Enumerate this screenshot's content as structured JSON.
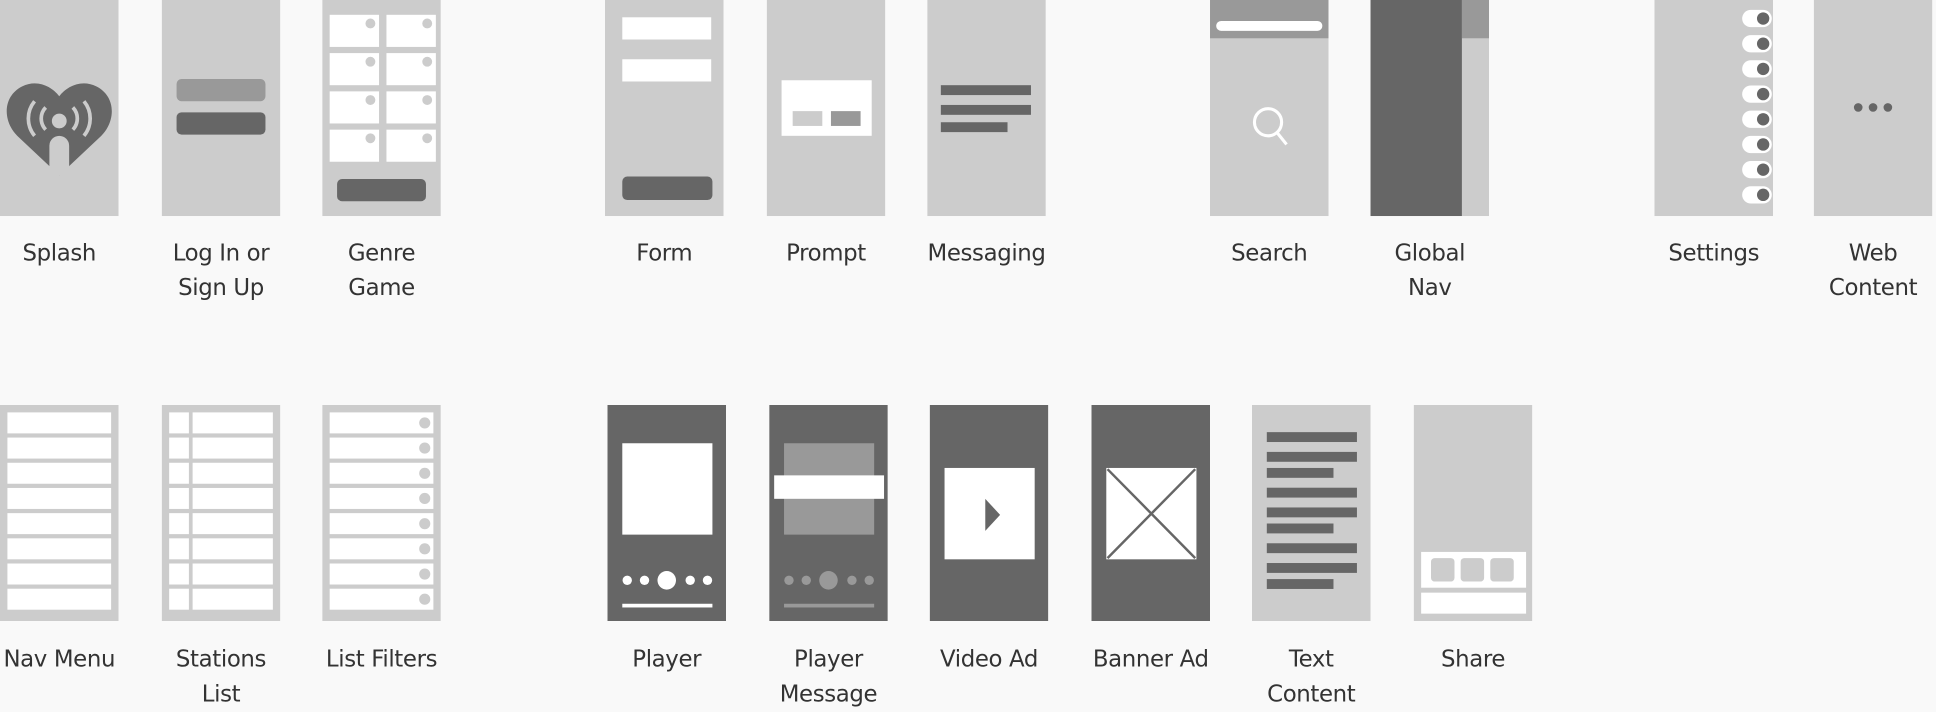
{
  "colors": {
    "background": "#f9f9f9",
    "light": "#cccccc",
    "mid": "#999999",
    "dark": "#666666",
    "white": "#ffffff",
    "text": "#333333"
  },
  "row1": [
    {
      "label": [
        "Splash"
      ],
      "icon": "iheart-logo-icon"
    },
    {
      "label": [
        "Log In or",
        "Sign Up"
      ]
    },
    {
      "label": [
        "Genre",
        "Game"
      ]
    },
    {
      "label": [
        "Form"
      ]
    },
    {
      "label": [
        "Prompt"
      ]
    },
    {
      "label": [
        "Messaging"
      ]
    },
    {
      "label": [
        "Search"
      ],
      "icon": "search-icon"
    },
    {
      "label": [
        "Global",
        "Nav"
      ]
    },
    {
      "label": [
        "Settings"
      ],
      "icon": "toggle-icon"
    },
    {
      "label": [
        "Web",
        "Content"
      ],
      "icon": "ellipsis-icon"
    }
  ],
  "row2": [
    {
      "label": [
        "Nav Menu"
      ]
    },
    {
      "label": [
        "Stations",
        "List"
      ]
    },
    {
      "label": [
        "List Filters"
      ]
    },
    {
      "label": [
        "Player"
      ]
    },
    {
      "label": [
        "Player",
        "Message"
      ]
    },
    {
      "label": [
        "Video Ad"
      ],
      "icon": "play-icon"
    },
    {
      "label": [
        "Banner Ad"
      ],
      "icon": "image-placeholder-icon"
    },
    {
      "label": [
        "Text",
        "Content"
      ]
    },
    {
      "label": [
        "Share"
      ]
    }
  ]
}
